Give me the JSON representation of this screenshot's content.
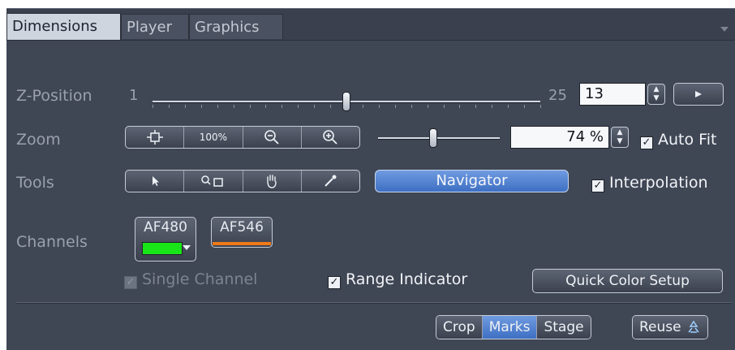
{
  "tabs": [
    {
      "label": "Dimensions",
      "active": true
    },
    {
      "label": "Player",
      "active": false
    },
    {
      "label": "Graphics",
      "active": false
    }
  ],
  "zposition": {
    "label": "Z-Position",
    "min": "1",
    "max": "25",
    "value": "13",
    "slider_fraction": 0.5,
    "play_icon": "play-icon"
  },
  "zoom": {
    "label": "Zoom",
    "buttons": [
      {
        "icon": "fit-icon",
        "label": ""
      },
      {
        "icon": "",
        "label": "100%"
      },
      {
        "icon": "zoom-out-icon",
        "label": ""
      },
      {
        "icon": "zoom-in-icon",
        "label": ""
      }
    ],
    "value": "74 %",
    "slider_fraction": 0.45,
    "auto_fit_label": "Auto Fit",
    "auto_fit_checked": true
  },
  "tools": {
    "label": "Tools",
    "buttons": [
      "pointer-icon",
      "magnify-rect-icon",
      "hand-icon",
      "eyedropper-icon"
    ],
    "navigator_label": "Navigator",
    "interpolation_label": "Interpolation",
    "interpolation_checked": true
  },
  "channels": {
    "label": "Channels",
    "items": [
      {
        "name": "AF480",
        "color": "#19e619"
      },
      {
        "name": "AF546",
        "color": "#f07a17"
      }
    ],
    "single_channel_label": "Single Channel",
    "range_indicator_label": "Range Indicator",
    "quick_color_label": "Quick Color Setup"
  },
  "bottom": {
    "buttons": [
      {
        "label": "Crop",
        "on": false
      },
      {
        "label": "Marks",
        "on": true
      },
      {
        "label": "Stage",
        "on": false
      }
    ],
    "reuse_label": "Reuse",
    "reuse_icon": "recycle-icon"
  },
  "colors": {
    "panel_bg": "#3f4654",
    "accent_blue": "#4f7fd2"
  }
}
